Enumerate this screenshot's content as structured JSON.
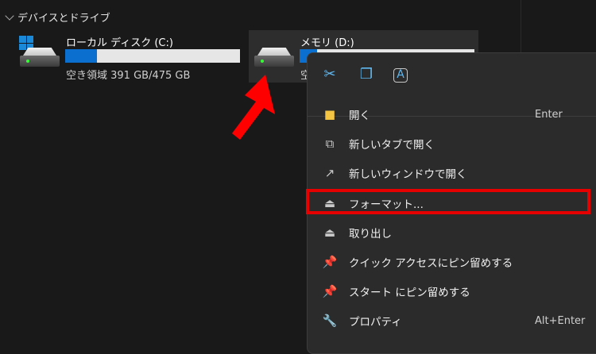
{
  "section": {
    "title": "デバイスとドライブ"
  },
  "drives": [
    {
      "name": "ローカル ディスク (C:)",
      "free_text": "空き領域 391 GB/475 GB",
      "used_fraction": 0.18
    },
    {
      "name": "メモリ (D:)",
      "free_text": "空",
      "used_fraction": 0.1
    }
  ],
  "menu": {
    "toolbar": [
      {
        "icon": "scissors-icon",
        "label": "切り取り"
      },
      {
        "icon": "copy-icon",
        "label": "コピー"
      },
      {
        "icon": "rename-icon",
        "label": "名前の変更"
      }
    ],
    "items": [
      {
        "label": "開く",
        "shortcut": "Enter",
        "icon": "folder-icon"
      },
      {
        "label": "新しいタブで開く",
        "shortcut": "",
        "icon": "new-tab-icon"
      },
      {
        "label": "新しいウィンドウで開く",
        "shortcut": "",
        "icon": "new-window-icon"
      },
      {
        "label": "フォーマット...",
        "shortcut": "",
        "icon": "format-icon"
      },
      {
        "label": "取り出し",
        "shortcut": "",
        "icon": "eject-icon"
      },
      {
        "label": "クイック アクセスにピン留めする",
        "shortcut": "",
        "icon": "pin-icon"
      },
      {
        "label": "スタート にピン留めする",
        "shortcut": "",
        "icon": "pin-icon"
      },
      {
        "label": "プロパティ",
        "shortcut": "Alt+Enter",
        "icon": "wrench-icon"
      }
    ]
  },
  "colors": {
    "accent": "#0a6fcf",
    "highlight": "#e60000"
  }
}
